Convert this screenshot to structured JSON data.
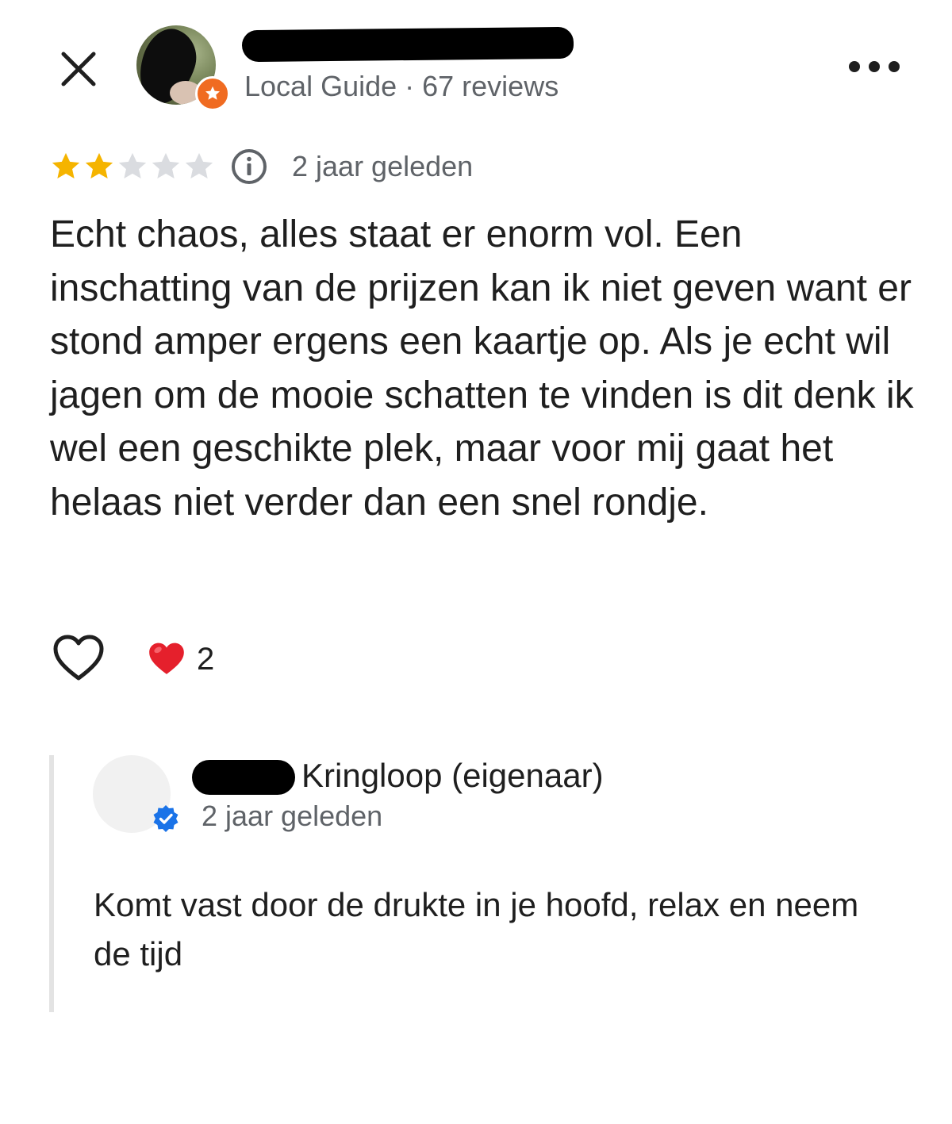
{
  "header": {
    "close_icon": "close-icon",
    "reviewer_meta": "Local Guide · 67 reviews",
    "more_icon": "more-horizontal-icon",
    "badge_color": "#f06b21"
  },
  "review": {
    "rating": 2,
    "max_rating": 5,
    "star_color_filled": "#f5b400",
    "star_color_empty": "#dadce0",
    "date": "2 jaar geleden",
    "text": "Echt chaos, alles staat er enorm vol. Een inschatting van de prijzen kan ik niet geven want er stond amper ergens een kaartje op. Als je echt wil jagen om de mooie schatten te vinden is dit denk ik wel een geschikte plek, maar voor mij gaat het helaas niet verder dan een snel rondje."
  },
  "reactions": {
    "like_icon": "heart-outline-icon",
    "emoji": "❤️",
    "count": "2"
  },
  "owner_reply": {
    "name": "Kringloop (eigenaar)",
    "date": "2 jaar geleden",
    "text": "Komt vast door de drukte in je hoofd, relax en neem de tijd",
    "verified_color": "#1a73e8"
  }
}
